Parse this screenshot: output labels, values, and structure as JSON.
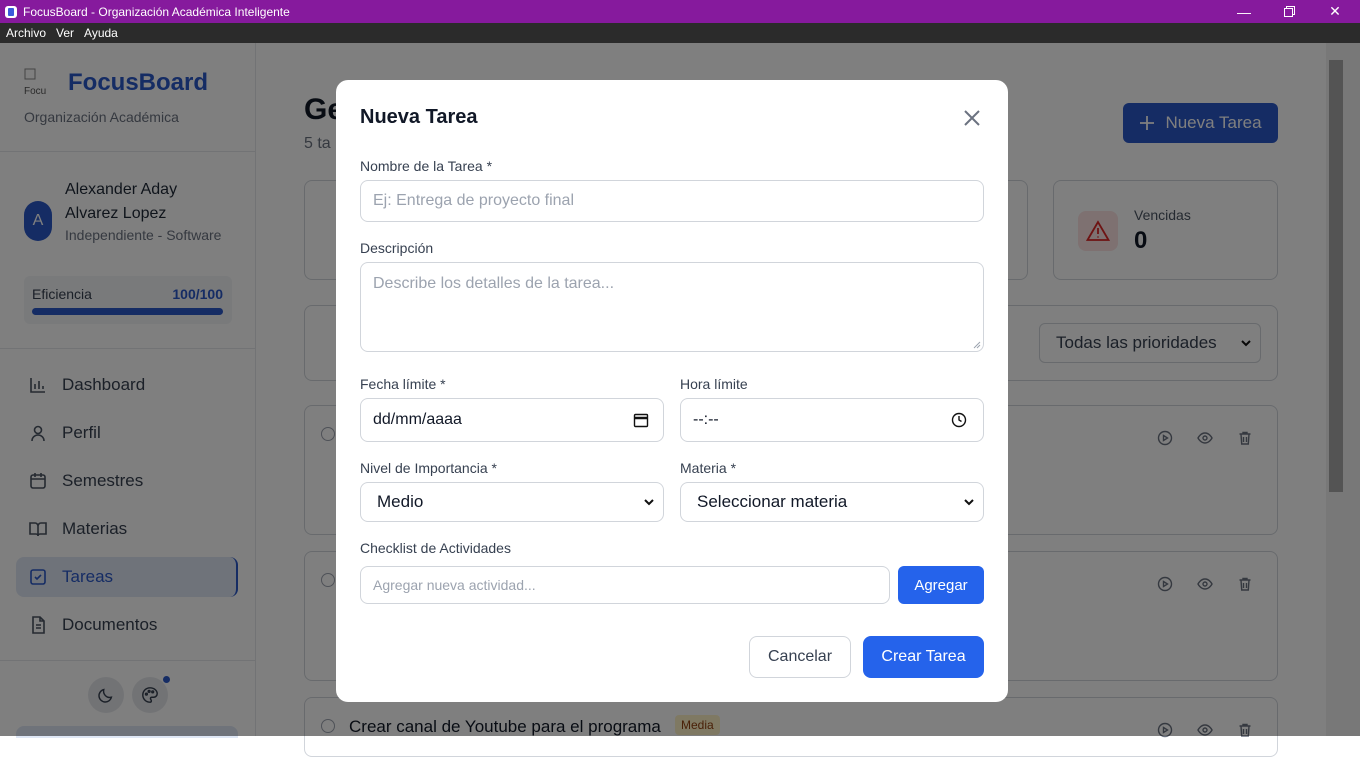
{
  "window": {
    "title": "FocusBoard - Organización Académica Inteligente"
  },
  "menu": [
    "Archivo",
    "Ver",
    "Ayuda"
  ],
  "sidebar": {
    "logo_alt": "Focu",
    "app_name": "FocusBoard",
    "app_subtitle": "Organización Académica",
    "user": {
      "initial": "A",
      "name": "Alexander Aday Alvarez Lopez",
      "role": "Independiente - Software"
    },
    "efficiency": {
      "label": "Eficiencia",
      "value": "100/100",
      "fraction": 1.0
    },
    "nav": [
      {
        "label": "Dashboard",
        "icon": "chart-bar-icon"
      },
      {
        "label": "Perfil",
        "icon": "user-icon"
      },
      {
        "label": "Semestres",
        "icon": "calendar-icon"
      },
      {
        "label": "Materias",
        "icon": "book-icon"
      },
      {
        "label": "Tareas",
        "icon": "checkbox-icon",
        "active": true
      },
      {
        "label": "Documentos",
        "icon": "document-icon"
      }
    ]
  },
  "main": {
    "title_fragment": "Ge",
    "subtitle_fragment": "5 ta",
    "new_task_button": "Nueva Tarea",
    "stat_vencidas": {
      "label": "Vencidas",
      "value": "0"
    },
    "priority_filter": "Todas las prioridades",
    "task_visible": {
      "name": "Crear canal de Youtube para el programa",
      "priority": "Media"
    }
  },
  "modal": {
    "title": "Nueva Tarea",
    "name_label": "Nombre de la Tarea *",
    "name_placeholder": "Ej: Entrega de proyecto final",
    "desc_label": "Descripción",
    "desc_placeholder": "Describe los detalles de la tarea...",
    "date_label": "Fecha límite *",
    "date_value": "dd/mm/aaaa",
    "time_label": "Hora límite",
    "time_value": "--:--",
    "importance_label": "Nivel de Importancia *",
    "importance_value": "Medio",
    "subject_label": "Materia *",
    "subject_value": "Seleccionar materia",
    "checklist_label": "Checklist de Actividades",
    "checklist_placeholder": "Agregar nueva actividad...",
    "add_button": "Agregar",
    "cancel_button": "Cancelar",
    "create_button": "Crear Tarea"
  },
  "colors": {
    "titlebar": "#861a9d",
    "primary": "#2b58c9",
    "accent_button": "#2563eb"
  }
}
